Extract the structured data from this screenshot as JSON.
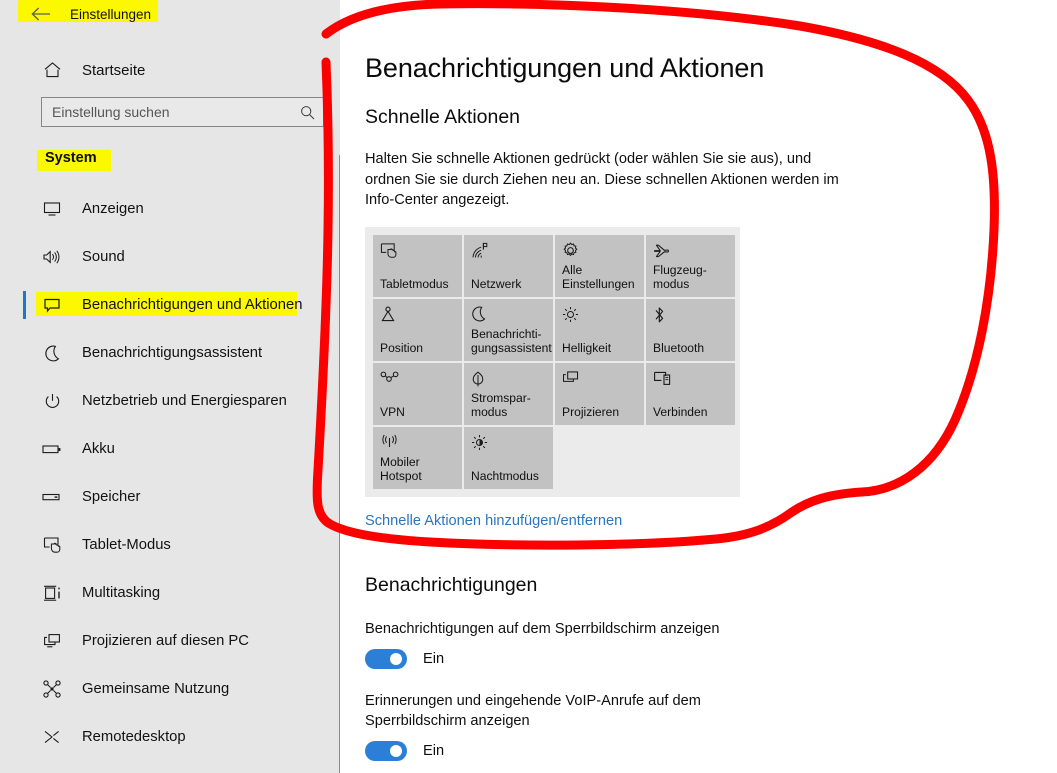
{
  "window": {
    "back_label": "zurück",
    "title": "Einstellungen"
  },
  "sidebar": {
    "home": {
      "label": "Startseite",
      "icon": "home-icon"
    },
    "search": {
      "placeholder": "Einstellung suchen",
      "value": "",
      "icon": "search-icon"
    },
    "group_header": "System",
    "items": [
      {
        "label": "Anzeigen",
        "icon": "monitor-icon",
        "selected": false
      },
      {
        "label": "Sound",
        "icon": "speaker-icon",
        "selected": false
      },
      {
        "label": "Benachrichtigungen und Aktionen",
        "icon": "notification-icon",
        "selected": true
      },
      {
        "label": "Benachrichtigungsassistent",
        "icon": "moon-icon",
        "selected": false
      },
      {
        "label": "Netzbetrieb und Energiesparen",
        "icon": "power-icon",
        "selected": false
      },
      {
        "label": "Akku",
        "icon": "battery-icon",
        "selected": false
      },
      {
        "label": "Speicher",
        "icon": "storage-icon",
        "selected": false
      },
      {
        "label": "Tablet-Modus",
        "icon": "tablet-touch-icon",
        "selected": false
      },
      {
        "label": "Multitasking",
        "icon": "multitasking-icon",
        "selected": false
      },
      {
        "label": "Projizieren auf diesen PC",
        "icon": "project-screen-icon",
        "selected": false
      },
      {
        "label": "Gemeinsame Nutzung",
        "icon": "share-icon",
        "selected": false
      },
      {
        "label": "Remotedesktop",
        "icon": "remote-desktop-icon",
        "selected": false
      }
    ]
  },
  "main": {
    "page_title": "Benachrichtigungen und Aktionen",
    "quick_actions": {
      "heading": "Schnelle Aktionen",
      "description": "Halten Sie schnelle Aktionen gedrückt (oder wählen Sie sie aus), und ordnen Sie sie durch Ziehen neu an. Diese schnellen Aktionen werden im Info-Center angezeigt.",
      "tiles": [
        {
          "label": "Tabletmodus",
          "icon": "tablet-touch-icon"
        },
        {
          "label": "Netzwerk",
          "icon": "wifi-icon"
        },
        {
          "label": "Alle Einstellungen",
          "icon": "gear-icon"
        },
        {
          "label": "Flugzeug-modus",
          "icon": "airplane-icon"
        },
        {
          "label": "Position",
          "icon": "location-icon"
        },
        {
          "label": "Benachrichti-gungsassistent",
          "icon": "moon-icon"
        },
        {
          "label": "Helligkeit",
          "icon": "brightness-icon"
        },
        {
          "label": "Bluetooth",
          "icon": "bluetooth-icon"
        },
        {
          "label": "VPN",
          "icon": "vpn-icon"
        },
        {
          "label": "Stromspar-modus",
          "icon": "battery-saver-icon"
        },
        {
          "label": "Projizieren",
          "icon": "project-screen-icon"
        },
        {
          "label": "Verbinden",
          "icon": "connect-device-icon"
        },
        {
          "label": "Mobiler Hotspot",
          "icon": "hotspot-icon"
        },
        {
          "label": "Nachtmodus",
          "icon": "night-light-icon"
        }
      ],
      "link": "Schnelle Aktionen hinzufügen/entfernen"
    },
    "notifications": {
      "heading": "Benachrichtigungen",
      "settings": [
        {
          "label": "Benachrichtigungen auf dem Sperrbildschirm anzeigen",
          "state": "Ein",
          "on": true
        },
        {
          "label": "Erinnerungen und eingehende VoIP-Anrufe auf dem Sperrbildschirm anzeigen",
          "state": "Ein",
          "on": true
        }
      ]
    }
  },
  "annotations": {
    "highlight_color": "#fbf800",
    "ink_color": "#fc0000",
    "highlighted_texts": [
      "Einstellungen",
      "System",
      "Benachrichtigungen und Aktionen"
    ],
    "circled_region": "Schnelle Aktionen section"
  },
  "theme": {
    "sidebar_bg": "#e6e6e6",
    "content_bg": "#ffffff",
    "accent": "#1e78c8",
    "link": "#2a74c0",
    "toggle_on": "#2c7fd6",
    "tile_bg": "#c2c2c2",
    "panel_bg": "#ebebeb"
  }
}
